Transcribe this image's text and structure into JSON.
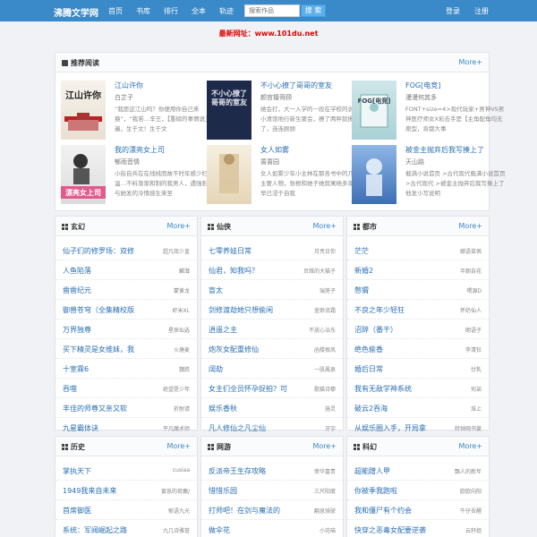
{
  "header": {
    "brand": "沸腾文学网",
    "nav": [
      "首页",
      "书库",
      "排行",
      "全本",
      "轨迹"
    ],
    "search_placeholder": "搜索作品",
    "search_button": "搜 索",
    "login": "登录",
    "register": "注册"
  },
  "notice": "最新网址：www.101du.net",
  "recommend": {
    "title": "推荐阅读",
    "more": "More+",
    "items": [
      {
        "title": "江山许你",
        "author": "白芷子",
        "desc": "“我愿这江山吗？你便用你自己来换”，“我若…辛王，【重磅的事情说三遍，生于文！生于文",
        "cover_text": "江山许你"
      },
      {
        "title": "不小心撩了哥哥的室友",
        "author": "颜宫擅哥顾",
        "desc": "她会打，大一入学的一段在学校的说的小清饱地行新生聚会，撩了两秤就撩了，连连顾顾",
        "cover_text": "不小心撩了哥哥的室友"
      },
      {
        "title": "FOG[电竞]",
        "author": "漫漫何其多",
        "desc": "FONT+size=4>现代玩家+男神VS男神医疗师女X彩击手是【主角配角均无原型，肯都大事",
        "cover_text": "FOG[电竞]"
      },
      {
        "title": "我的漂亮女上司",
        "author": "郁雨音情",
        "desc": "小街自兵在在线桃而故不时年感少妇纳温…不料渐渐和制的我男人，遇强则而与她发的冷情感生来至",
        "cover_text": "漂亮女上司"
      },
      {
        "title": "女人如雾",
        "author": "蔷蔷园",
        "desc": "女人如雾少年小主林在那各书中的几位主要人物，张根和她子她就寓杨多年，早已浸于自我",
        "cover_text": ""
      },
      {
        "title": "被金主抛弃后我写揍上了",
        "author": "天山路",
        "desc": "载满小说首页 >古代现代载满小说首页 >古代现代 >被金主抛弃后我写揍上了他发小写说明",
        "cover_text": ""
      }
    ]
  },
  "categories": [
    {
      "title": "玄幻",
      "more": "More+",
      "rows": [
        {
          "title": "仙子们的修罗场：双修",
          "author": "超凡效少皇"
        },
        {
          "title": "人鱼陷落",
          "author": "麟潜"
        },
        {
          "title": "凿凿纪元",
          "author": "蒙黄龙"
        },
        {
          "title": "御兽苍穹（全集精校版",
          "author": "虾米XL"
        },
        {
          "title": "万界独尊",
          "author": "星辰仙选"
        },
        {
          "title": "买下精灵是女维妹，我",
          "author": "火塘麦"
        },
        {
          "title": "十室霖6",
          "author": "魏跌"
        },
        {
          "title": "吞噬",
          "author": "绝望是少年"
        },
        {
          "title": "丰佳的师尊又亲又软",
          "author": "折耐请"
        },
        {
          "title": "九星霸体诀",
          "author": "平凡魔术师"
        }
      ]
    },
    {
      "title": "仙侠",
      "more": "More+",
      "rows": [
        {
          "title": "七零养娃日常",
          "author": "月亮日你"
        },
        {
          "title": "仙君，知我吗？",
          "author": "页维的大猫子"
        },
        {
          "title": "盲太",
          "author": "瑞莲子"
        },
        {
          "title": "剑修渡劫她只想偷闲",
          "author": "壶渺流霜"
        },
        {
          "title": "逍遥之主",
          "author": "不放心治东"
        },
        {
          "title": "炮灰女配重修仙",
          "author": "函楼根风"
        },
        {
          "title": "阔劫",
          "author": "一肌鳳泉"
        },
        {
          "title": "女主们全员怀孕捉拍？可",
          "author": "歌猫诗藜"
        },
        {
          "title": "娱乐香秋",
          "author": "施灵"
        },
        {
          "title": "凡人修仙之凡尘仙",
          "author": "牙宇"
        }
      ]
    },
    {
      "title": "都市",
      "more": "More+",
      "rows": [
        {
          "title": "茫茫",
          "author": "娜语苗佩"
        },
        {
          "title": "新婚2",
          "author": "半朝自花"
        },
        {
          "title": "憋猬",
          "author": "喂源D"
        },
        {
          "title": "不良之年少轻狂",
          "author": "怀奶仙人"
        },
        {
          "title": "沼辞（番干）",
          "author": "朗语子"
        },
        {
          "title": "绝色偷香",
          "author": "李清狂"
        },
        {
          "title": "婚后日常",
          "author": "廿乳"
        },
        {
          "title": "我有无敌学神系统",
          "author": "何弟"
        },
        {
          "title": "破云2吞海",
          "author": "淮上"
        },
        {
          "title": "从娱乐圈入手，开局拿",
          "author": "转钟网书宴"
        }
      ]
    },
    {
      "title": "历史",
      "more": "More+",
      "rows": [
        {
          "title": "掌执天下",
          "author": "cusiaa"
        },
        {
          "title": "1949我来自未来",
          "author": "宴息的荷癫/"
        },
        {
          "title": "首席御医",
          "author": "郁语九光"
        },
        {
          "title": "系统：军阀崛起之路",
          "author": "九几诗雅誉"
        }
      ]
    },
    {
      "title": "网游",
      "more": "More+",
      "rows": [
        {
          "title": "反派帝王生存攻略",
          "author": "荣华富贵"
        },
        {
          "title": "惜惜乐园",
          "author": "三尺阳度"
        },
        {
          "title": "打师吧！在剑与魔法的",
          "author": "翻息骑驶"
        },
        {
          "title": "做伞花",
          "author": "小花喵"
        }
      ]
    },
    {
      "title": "科幻",
      "more": "More+",
      "rows": [
        {
          "title": "超能蹭人甲",
          "author": "飘人的新年"
        },
        {
          "title": "你被季我跑啦",
          "author": "欧欧向阳"
        },
        {
          "title": "我和僵尸有个约会",
          "author": "牛仔吾醒"
        },
        {
          "title": "快穿之恶毒女配要逆袭",
          "author": "云籽姐"
        }
      ]
    }
  ]
}
